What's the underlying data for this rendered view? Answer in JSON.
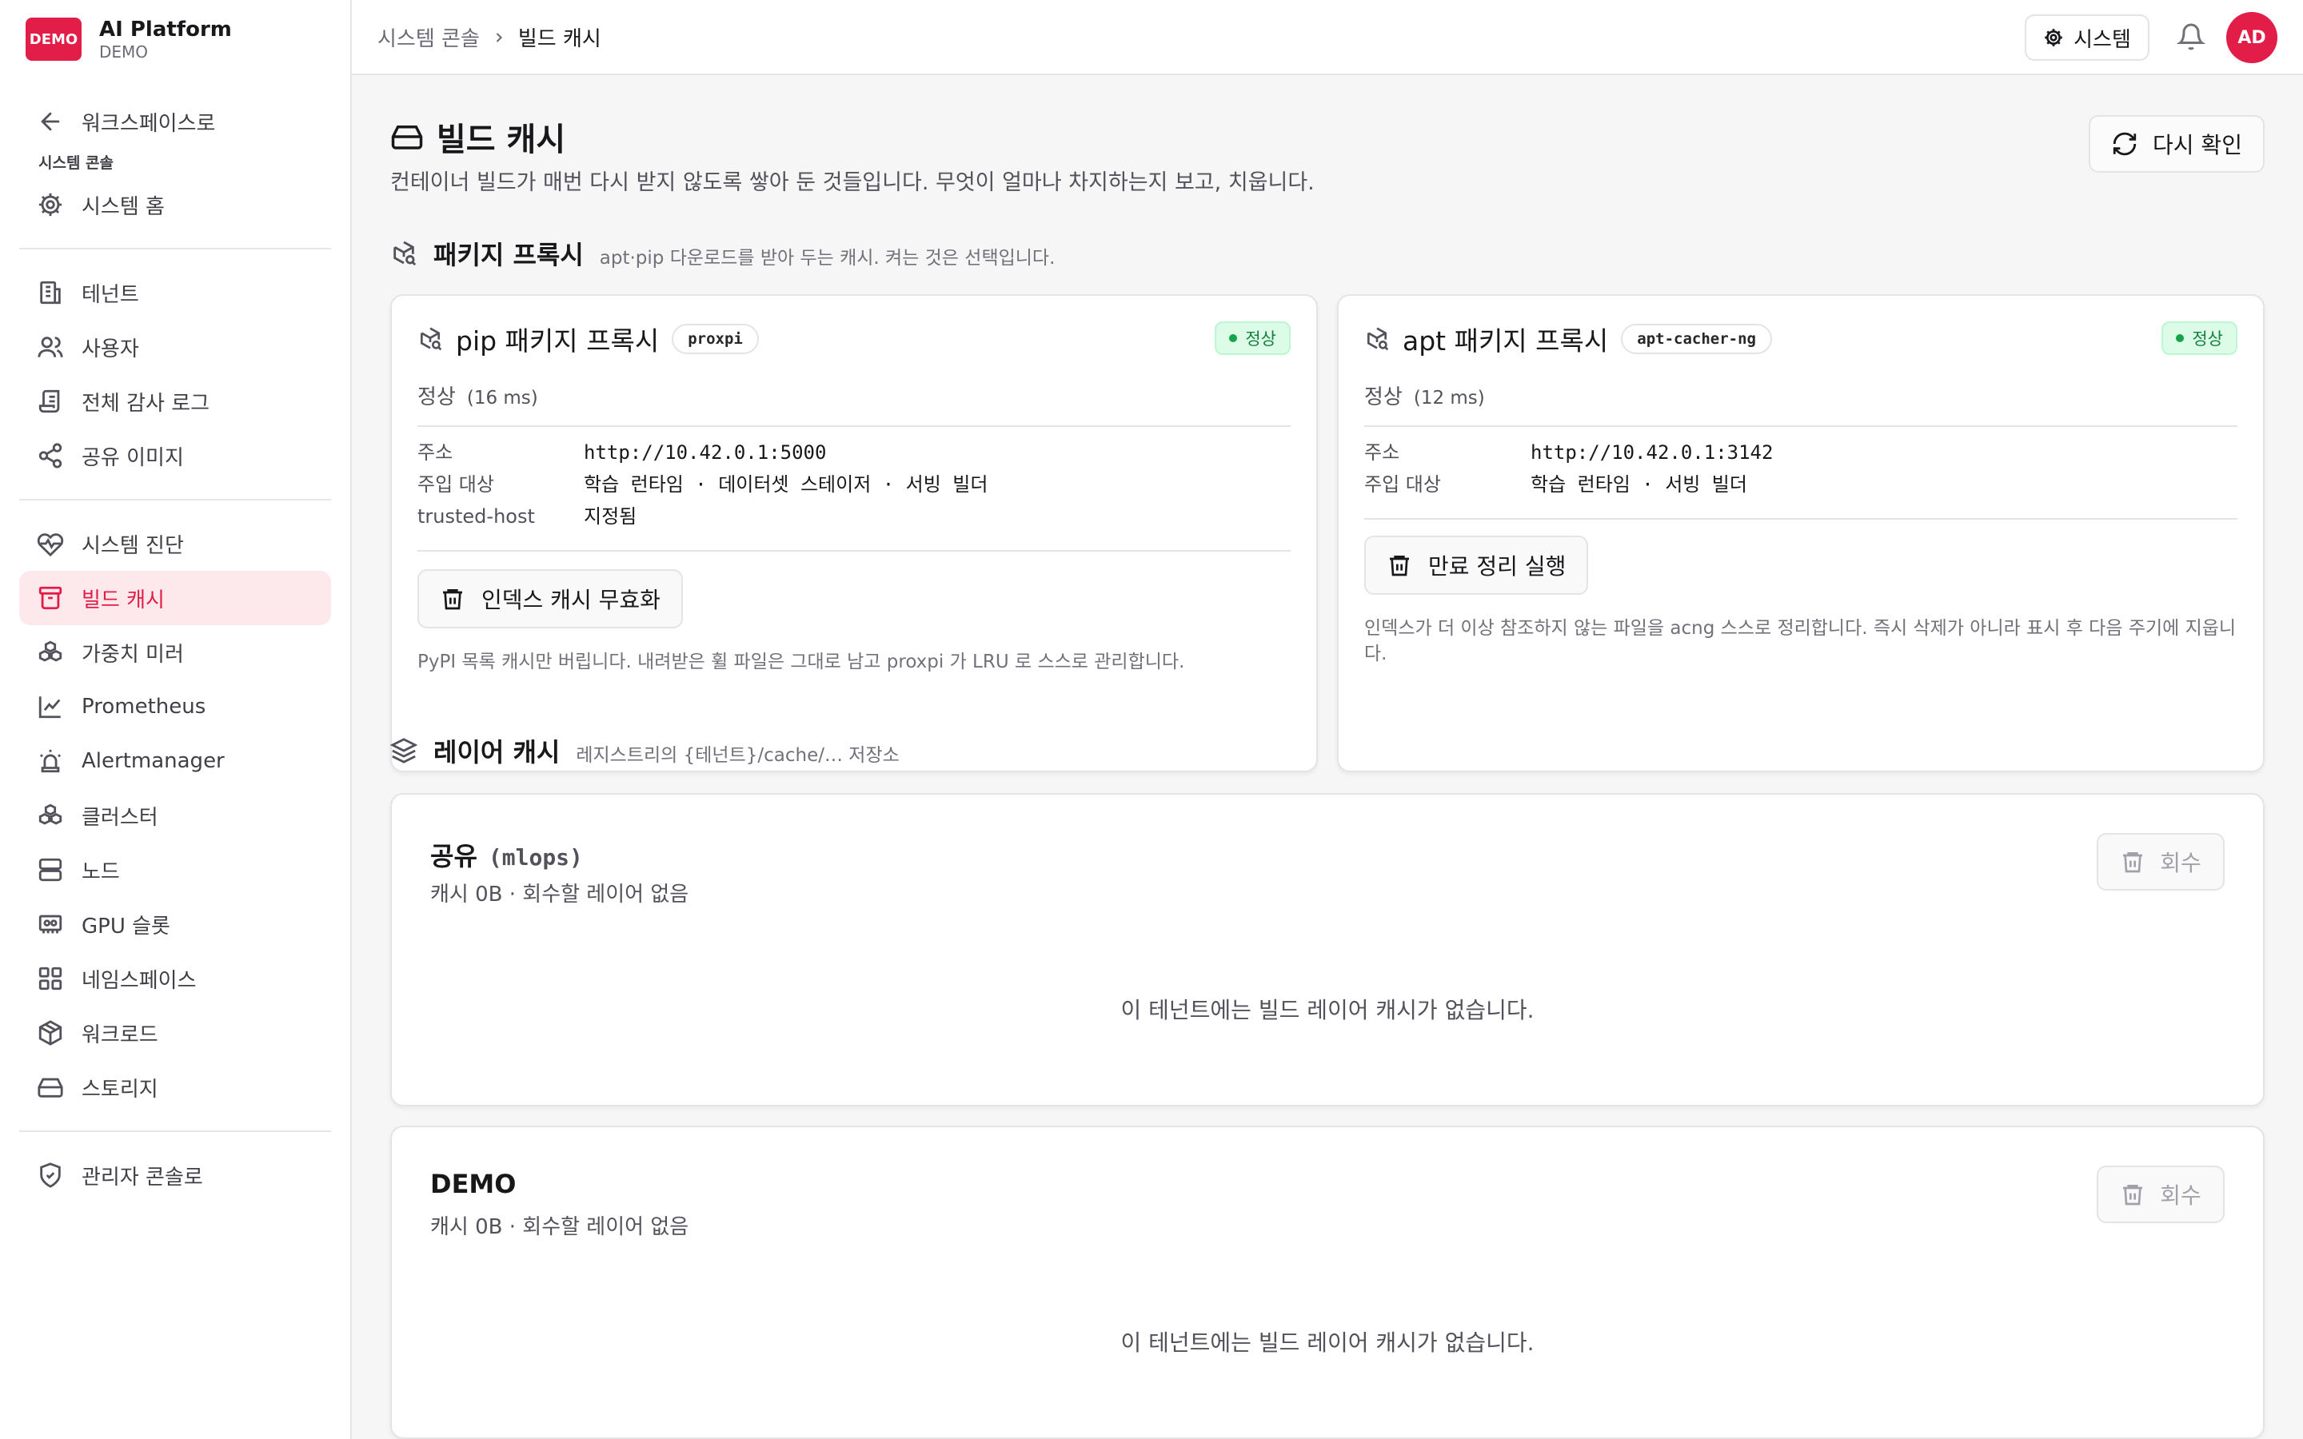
{
  "brand": {
    "logo_text": "DEMO",
    "title": "AI Platform",
    "subtitle": "DEMO",
    "accent": "#e11d48"
  },
  "sidebar": {
    "back": {
      "label": "워크스페이스로",
      "icon": "arrow-left-icon"
    },
    "section_label": "시스템 콘솔",
    "home": {
      "label": "시스템 홈",
      "icon": "gear-icon"
    },
    "group1": [
      {
        "label": "테넌트",
        "icon": "building-icon"
      },
      {
        "label": "사용자",
        "icon": "users-icon"
      },
      {
        "label": "전체 감사 로그",
        "icon": "scroll-icon"
      },
      {
        "label": "공유 이미지",
        "icon": "share-icon"
      }
    ],
    "group2": [
      {
        "label": "시스템 진단",
        "icon": "heart-pulse-icon"
      },
      {
        "label": "빌드 캐시",
        "icon": "archive-icon"
      },
      {
        "label": "가중치 미러",
        "icon": "boxes-icon"
      },
      {
        "label": "Prometheus",
        "icon": "line-chart-icon"
      },
      {
        "label": "Alertmanager",
        "icon": "siren-icon"
      },
      {
        "label": "클러스터",
        "icon": "boxes-icon"
      },
      {
        "label": "노드",
        "icon": "server-icon"
      },
      {
        "label": "GPU 슬롯",
        "icon": "gpu-icon"
      },
      {
        "label": "네임스페이스",
        "icon": "grid-icon"
      },
      {
        "label": "워크로드",
        "icon": "package-icon"
      },
      {
        "label": "스토리지",
        "icon": "hard-drive-icon"
      }
    ],
    "admin": {
      "label": "관리자 콘솔로",
      "icon": "shield-check-icon"
    }
  },
  "topbar": {
    "breadcrumb": [
      "시스템 콘솔",
      "빌드 캐시"
    ],
    "system_button": "시스템",
    "avatar": "AD"
  },
  "page": {
    "title": "빌드 캐시",
    "description": "컨테이너 빌드가 매번 다시 받지 않도록 쌓아 둔 것들입니다. 무엇이 얼마나 차지하는지 보고, 치웁니다.",
    "recheck_button": "다시 확인"
  },
  "proxy_section": {
    "title": "패키지 프록시",
    "subtitle": "apt·pip 다운로드를 받아 두는 캐시. 켜는 것은 선택입니다.",
    "cards": [
      {
        "title": "pip 패키지 프록시",
        "tag": "proxpi",
        "status": "정상",
        "health": "정상",
        "latency": "(16 ms)",
        "rows": [
          {
            "k": "주소",
            "v": "http://10.42.0.1:5000",
            "mono": true
          },
          {
            "k": "주입 대상",
            "v": "학습 런타임 · 데이터셋 스테이저 · 서빙 빌더",
            "mono": true
          },
          {
            "k": "trusted-host",
            "v": "지정됨",
            "mono": false
          }
        ],
        "action": "인덱스 캐시 무효화",
        "note": "PyPI 목록 캐시만 버립니다. 내려받은 휠 파일은 그대로 남고 proxpi 가 LRU 로 스스로 관리합니다."
      },
      {
        "title": "apt 패키지 프록시",
        "tag": "apt-cacher-ng",
        "status": "정상",
        "health": "정상",
        "latency": "(12 ms)",
        "rows": [
          {
            "k": "주소",
            "v": "http://10.42.0.1:3142",
            "mono": true
          },
          {
            "k": "주입 대상",
            "v": "학습 런타임 · 서빙 빌더",
            "mono": true
          }
        ],
        "action": "만료 정리 실행",
        "note": "인덱스가 더 이상 참조하지 않는 파일을 acng 스스로 정리합니다. 즉시 삭제가 아니라 표시 후 다음 주기에 지웁니다."
      }
    ]
  },
  "layer_section": {
    "title": "레이어 캐시",
    "subtitle": "레지스트리의 {테넌트}/cache/… 저장소",
    "cards": [
      {
        "name": "공유",
        "code": "(mlops)",
        "summary": "캐시 0B · 회수할 레이어 없음",
        "button": "회수",
        "empty": "이 테넌트에는 빌드 레이어 캐시가 없습니다."
      },
      {
        "name": "DEMO",
        "code": "",
        "summary": "캐시 0B · 회수할 레이어 없음",
        "button": "회수",
        "empty": "이 테넌트에는 빌드 레이어 캐시가 없습니다."
      }
    ]
  },
  "colors": {
    "status_ok": "#16a34a",
    "active_bg": "#fde8ec"
  }
}
